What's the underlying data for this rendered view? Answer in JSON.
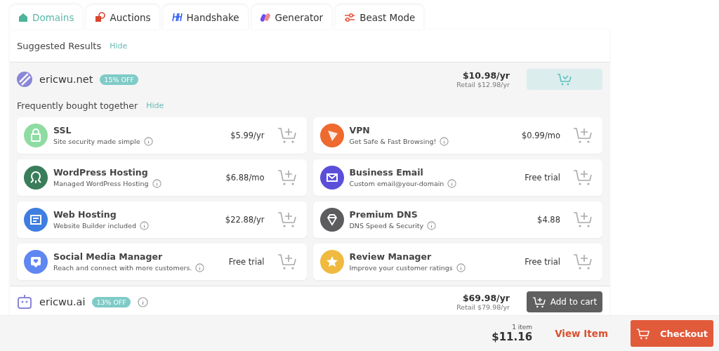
{
  "tabs": [
    {
      "label": "Domains",
      "selected": true
    },
    {
      "label": "Auctions",
      "selected": false
    },
    {
      "label": "Handshake",
      "selected": false
    },
    {
      "label": "Generator",
      "selected": false
    },
    {
      "label": "Beast Mode",
      "selected": false
    }
  ],
  "suggested": {
    "title": "Suggested Results",
    "hide": "Hide"
  },
  "results": [
    {
      "domain": "ericwu.net",
      "discount": "15% OFF",
      "price": "$10.98/yr",
      "retail": "Retail $12.98/yr",
      "in_cart": true,
      "info": false,
      "together": {
        "title": "Frequently bought together",
        "hide": "Hide",
        "addons": [
          {
            "name": "SSL",
            "desc": "Site security made simple",
            "price": "$5.99/yr",
            "color": "#8fdca3"
          },
          {
            "name": "VPN",
            "desc": "Get Safe & Fast Browsing!",
            "price": "$0.99/mo",
            "color": "#ee6a2f"
          },
          {
            "name": "WordPress Hosting",
            "desc": "Managed WordPress Hosting",
            "price": "$6.88/mo",
            "color": "#3a7d5a"
          },
          {
            "name": "Business Email",
            "desc": "Custom email@your-domain",
            "price": "Free trial",
            "color": "#5b4fd9"
          },
          {
            "name": "Web Hosting",
            "desc": "Website Builder included",
            "price": "$22.88/yr",
            "color": "#3f7ee0"
          },
          {
            "name": "Premium DNS",
            "desc": "DNS Speed & Security",
            "price": "$4.88",
            "color": "#5c5c5e"
          },
          {
            "name": "Social Media Manager",
            "desc": "Reach and connect with more customers.",
            "price": "Free trial",
            "color": "#5f87f2"
          },
          {
            "name": "Review Manager",
            "desc": "Improve your customer ratings",
            "price": "Free trial",
            "color": "#efba3f"
          }
        ]
      }
    },
    {
      "domain": "ericwu.ai",
      "discount": "13% OFF",
      "price": "$69.98/yr",
      "retail": "Retail $79.98/yr",
      "in_cart": false,
      "info": true,
      "button": "Add to cart"
    }
  ],
  "footer": {
    "count": "1 item",
    "total": "$11.16",
    "view": "View Item",
    "checkout": "Checkout"
  }
}
